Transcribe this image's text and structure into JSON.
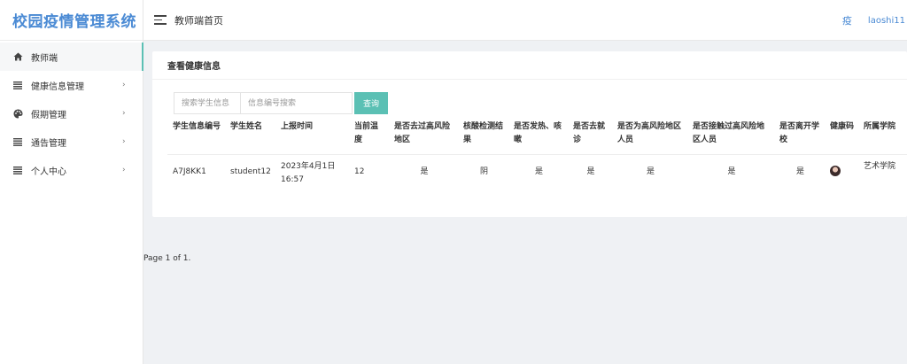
{
  "app": {
    "title": "校园疫情管理系统"
  },
  "sidebar": {
    "items": [
      {
        "label": "教师端",
        "icon": "home-icon",
        "active": true
      },
      {
        "label": "健康信息管理",
        "icon": "list-icon",
        "chevron": "›"
      },
      {
        "label": "假期管理",
        "icon": "palette-icon",
        "chevron": "›"
      },
      {
        "label": "通告管理",
        "icon": "list-icon",
        "chevron": "›"
      },
      {
        "label": "个人中心",
        "icon": "list-icon",
        "chevron": "›"
      }
    ]
  },
  "header": {
    "title": "教师端首页",
    "logo_char": "疫",
    "user": "laoshi11"
  },
  "card": {
    "title": "查看健康信息"
  },
  "search": {
    "student_placeholder": "搜索学生信息",
    "code_placeholder": "信息编号搜索",
    "button_label": "查询"
  },
  "table": {
    "columns": [
      "学生信息编号",
      "学生姓名",
      "上报时间",
      "当前温度",
      "是否去过高风险地区",
      "核酸检测结果",
      "是否发热、咳嗽",
      "是否去就诊",
      "是否为高风险地区人员",
      "是否接触过高风险地区人员",
      "是否离开学校",
      "健康码",
      "所属学院"
    ],
    "rows": [
      {
        "code": "A7J8KK1",
        "name": "student12",
        "time": "2023年4月1日16:57",
        "temp": "12",
        "risk_visit": "是",
        "nucleic": "阴",
        "fever": "是",
        "clinic": "是",
        "risk_person": "是",
        "risk_contact": "是",
        "left_school": "是",
        "college": "艺术学院"
      }
    ]
  },
  "pager": {
    "text": "Page 1 of 1."
  },
  "colors": {
    "accent": "#5bc0b4",
    "brand": "#4a8ad4"
  }
}
